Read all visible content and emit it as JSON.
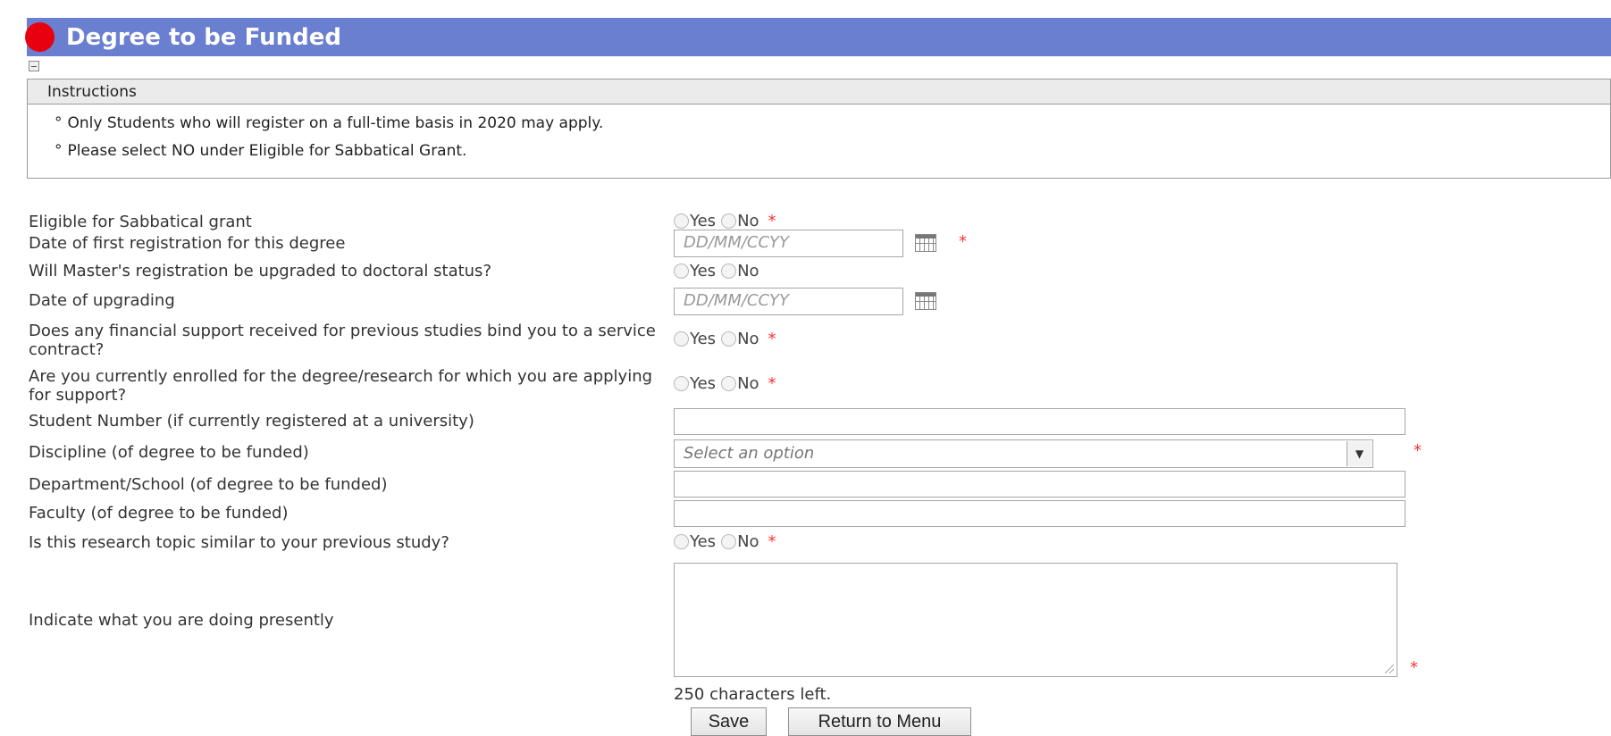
{
  "section": {
    "title": "Degree to be Funded",
    "status_color": "#e8000e",
    "header_color": "#6a7fcf"
  },
  "instructions": {
    "heading": "Instructions",
    "items": [
      "Only Students who will register on a full-time basis in 2020 may apply.",
      "Please select NO under Eligible for Sabbatical Grant."
    ]
  },
  "form": {
    "yes_label": "Yes",
    "no_label": "No",
    "required_mark": "*",
    "date_placeholder": "DD/MM/CCYY",
    "fields": {
      "sabbatical": "Eligible for Sabbatical grant",
      "first_registration_date": "Date of first registration for this degree",
      "upgrade_to_doctoral": "Will Master's registration be upgraded to doctoral status?",
      "upgrading_date": "Date of upgrading",
      "service_contract": "Does any financial support received for previous studies bind you to a service contract?",
      "currently_enrolled": "Are you currently enrolled for the degree/research for which you are applying for support?",
      "student_number": "Student Number (if currently registered at a university)",
      "discipline": "Discipline (of degree to be funded)",
      "department": "Department/School (of degree to be funded)",
      "faculty": "Faculty (of degree to be funded)",
      "similar_topic": "Is this research topic similar to your previous study?",
      "doing_presently": "Indicate what you are doing presently"
    },
    "discipline_selected": "Select an option",
    "chars_left": "250 characters left."
  },
  "buttons": {
    "save": "Save",
    "return_to_menu": "Return to Menu"
  }
}
